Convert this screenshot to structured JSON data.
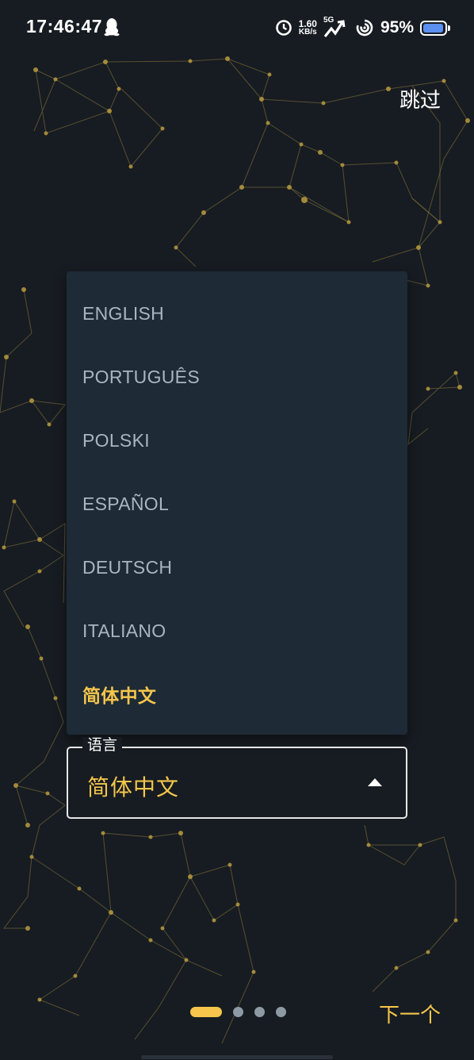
{
  "status_bar": {
    "time": "17:46:47",
    "speed_value": "1.60",
    "speed_unit": "KB/s",
    "network": "5G",
    "battery_percent": "95%",
    "battery_level": 0.95,
    "icons": [
      "qq-penguin-icon",
      "alarm-icon",
      "signal-icon",
      "hotspot-icon",
      "battery-icon"
    ]
  },
  "header": {
    "skip_label": "跳过"
  },
  "language_menu": {
    "items": [
      {
        "label": "ENGLISH"
      },
      {
        "label": "PORTUGUÊS"
      },
      {
        "label": "POLSKI"
      },
      {
        "label": "ESPAÑOL"
      },
      {
        "label": "DEUTSCH"
      },
      {
        "label": "ITALIANO"
      },
      {
        "label": "简体中文",
        "selected": true
      }
    ]
  },
  "language_field": {
    "label": "语言",
    "value": "简体中文"
  },
  "pager": {
    "total": 4,
    "current": 1
  },
  "footer": {
    "next_label": "下一个"
  },
  "colors": {
    "background": "#171c22",
    "menu_background": "#1e2a36",
    "accent": "#f5c64b",
    "menu_text": "#a9b6c2",
    "network_lines": "#8a7a3c"
  }
}
